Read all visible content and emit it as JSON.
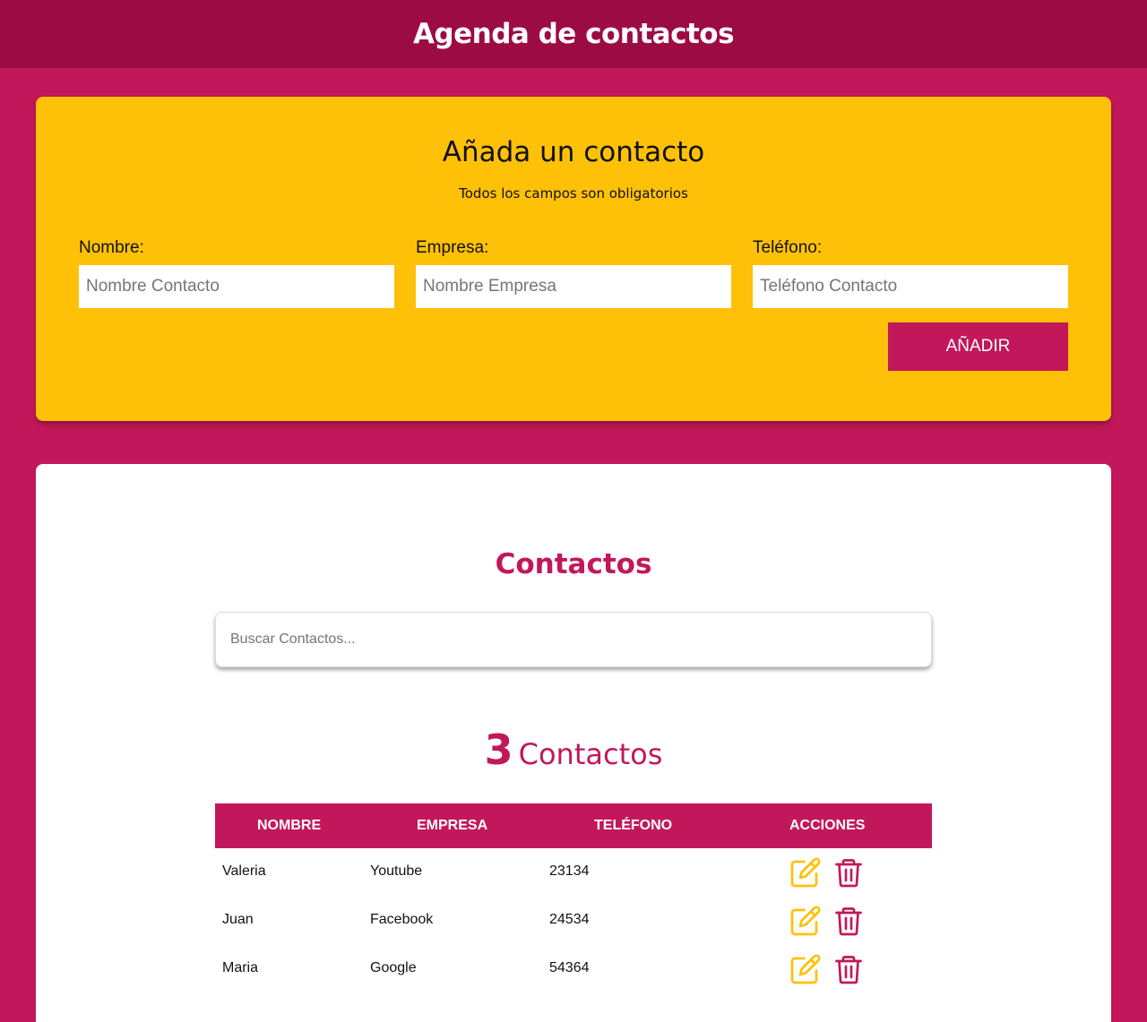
{
  "header": {
    "title": "Agenda de contactos"
  },
  "form": {
    "title": "Añada un contacto",
    "subtitle": "Todos los campos son obligatorios",
    "fields": [
      {
        "label": "Nombre:",
        "placeholder": "Nombre Contacto"
      },
      {
        "label": "Empresa:",
        "placeholder": "Nombre Empresa"
      },
      {
        "label": "Teléfono:",
        "placeholder": "Teléfono Contacto"
      }
    ],
    "submit_label": "AÑADIR"
  },
  "contacts": {
    "title": "Contactos",
    "search_placeholder": "Buscar Contactos...",
    "count": "3",
    "count_label": "Contactos",
    "columns": [
      "NOMBRE",
      "EMPRESA",
      "TELÉFONO",
      "ACCIONES"
    ],
    "rows": [
      {
        "nombre": "Valeria",
        "empresa": "Youtube",
        "telefono": "23134"
      },
      {
        "nombre": "Juan",
        "empresa": "Facebook",
        "telefono": "24534"
      },
      {
        "nombre": "Maria",
        "empresa": "Google",
        "telefono": "54364"
      }
    ],
    "edit_icon": "pencil-square-icon",
    "delete_icon": "trash-icon"
  },
  "colors": {
    "primary": "#c2185b",
    "header_bg": "#9d0b45",
    "accent": "#ffc107",
    "card": "#ffffff"
  }
}
